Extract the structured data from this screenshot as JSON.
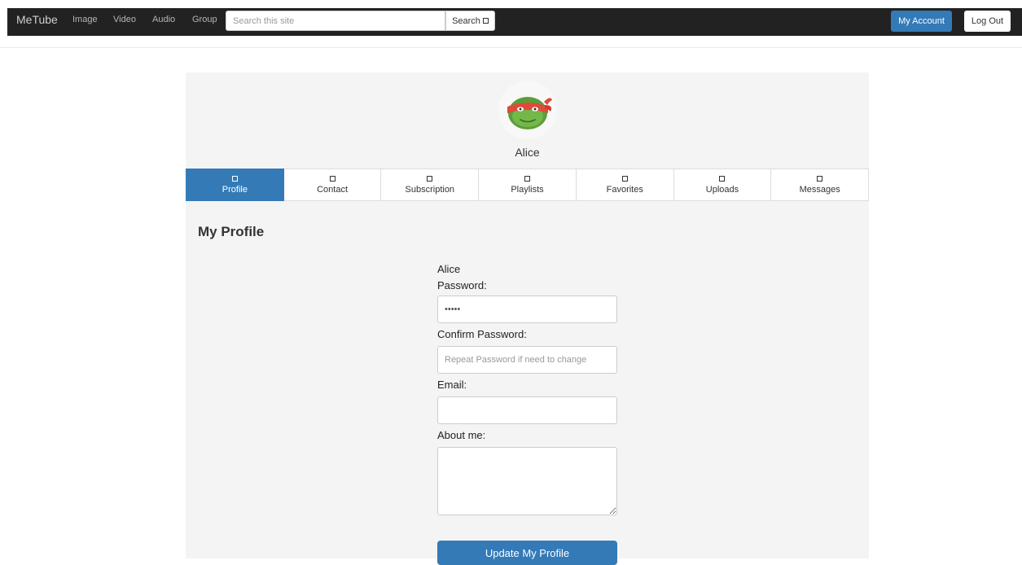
{
  "navbar": {
    "brand": "MeTube",
    "links": [
      "Image",
      "Video",
      "Audio",
      "Group"
    ],
    "search_placeholder": "Search this site",
    "search_label": "Search",
    "account_label": "My Account",
    "logout_label": "Log Out"
  },
  "profile": {
    "username": "Alice",
    "avatar_icon": "ninja-turtle-avatar-icon"
  },
  "tabs": [
    {
      "label": "Profile",
      "active": true
    },
    {
      "label": "Contact"
    },
    {
      "label": "Subscription"
    },
    {
      "label": "Playlists"
    },
    {
      "label": "Favorites"
    },
    {
      "label": "Uploads"
    },
    {
      "label": "Messages"
    }
  ],
  "main": {
    "title": "My Profile",
    "display_name": "Alice",
    "password_label": "Password:",
    "password_value": "•••••",
    "confirm_label": "Confirm Password:",
    "confirm_placeholder": "Repeat Password if need to change",
    "email_label": "Email:",
    "email_value": "",
    "about_label": "About me:",
    "about_value": "",
    "submit_label": "Update My Profile"
  },
  "colors": {
    "primary": "#337ab7",
    "navbar": "#222222",
    "panel": "#f4f4f4"
  }
}
